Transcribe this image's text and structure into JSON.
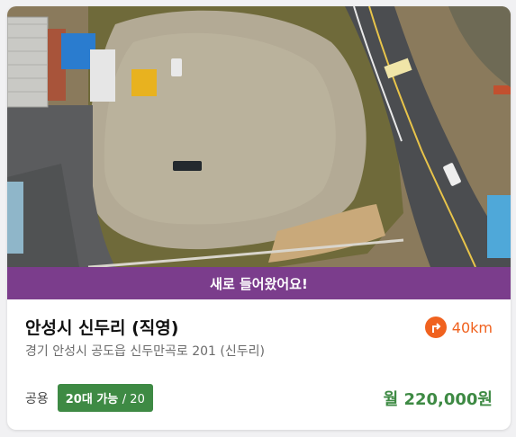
{
  "listing": {
    "banner": "새로 들어왔어요!",
    "title": "안성시 신두리 (직영)",
    "address": "경기 안성시 공도읍 신두만곡로 201 (신두리)",
    "distance": "40km",
    "distance_icon": "turn-right-icon",
    "usage_label": "공용",
    "capacity_available": "20대 가능",
    "capacity_total": "/ 20",
    "price": "월 220,000원"
  },
  "colors": {
    "banner_bg": "#7b3d8c",
    "accent_orange": "#f0621f",
    "accent_green": "#3e8a44"
  }
}
